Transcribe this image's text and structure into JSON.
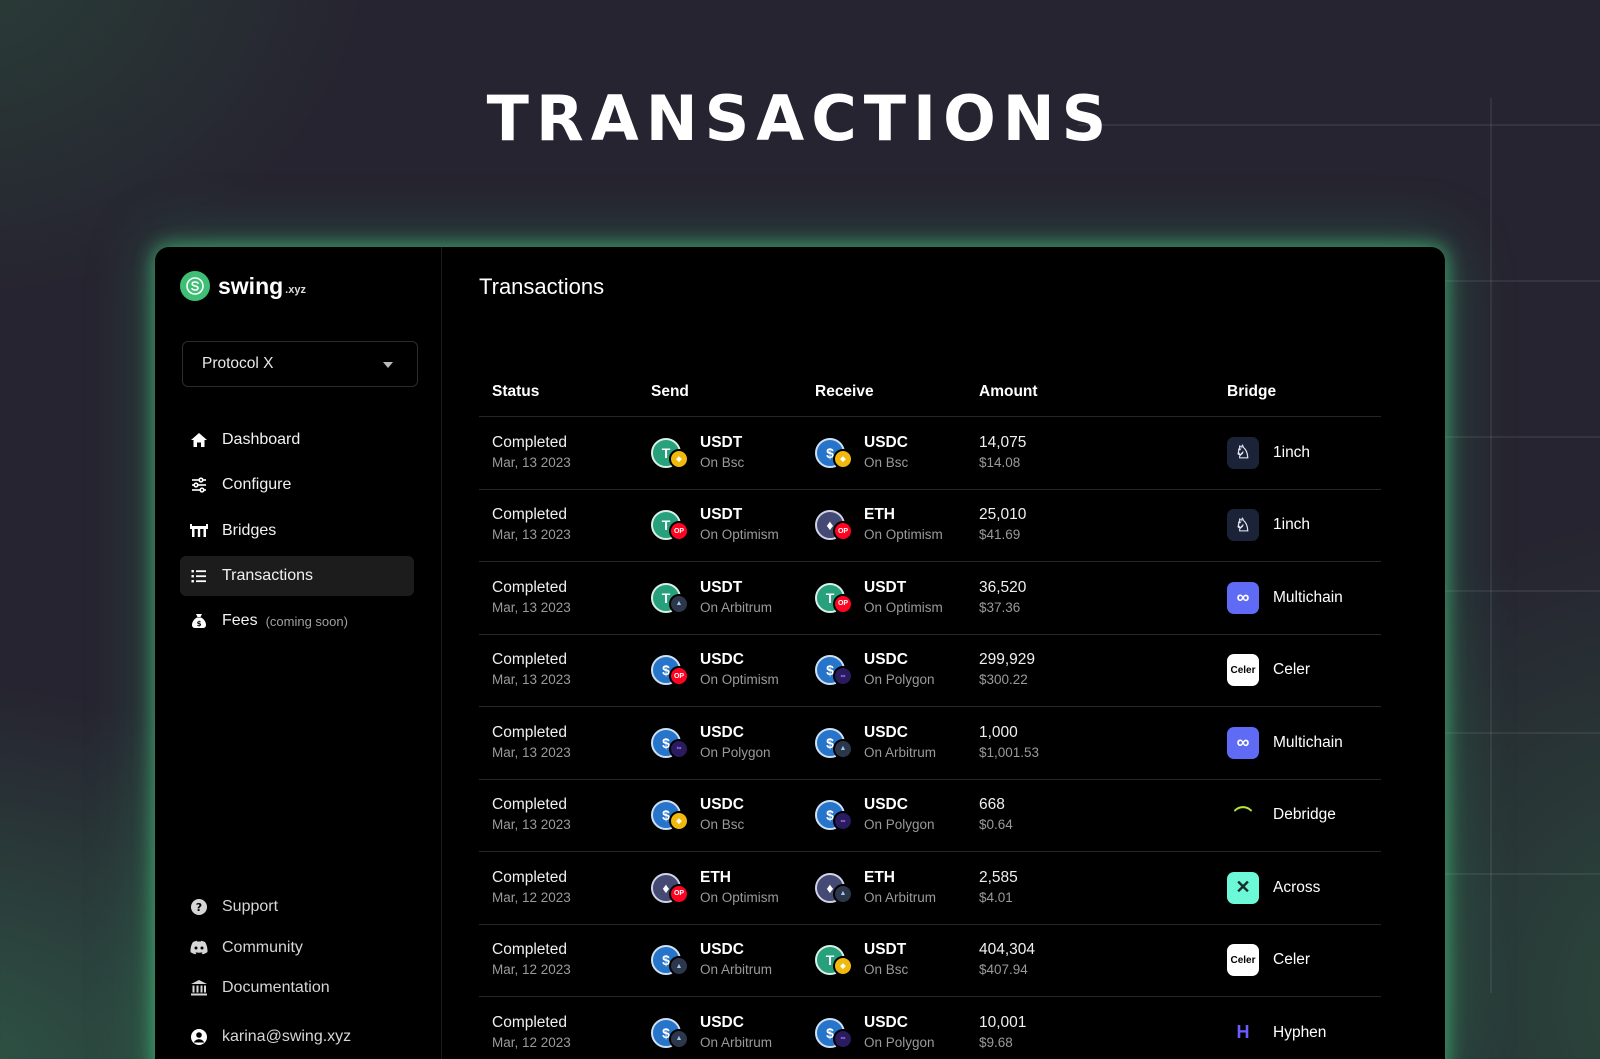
{
  "hero": {
    "title": "TRANSACTIONS"
  },
  "app": {
    "logo": {
      "text": "swing",
      "suffix": ".xyz"
    },
    "protocol_select": {
      "value": "Protocol X"
    },
    "nav": [
      {
        "label": "Dashboard",
        "icon": "home-icon"
      },
      {
        "label": "Configure",
        "icon": "sliders-icon"
      },
      {
        "label": "Bridges",
        "icon": "bridge-icon"
      },
      {
        "label": "Transactions",
        "icon": "list-icon",
        "active": true
      },
      {
        "label": "Fees",
        "note": "(coming soon)",
        "icon": "money-bag-icon"
      }
    ],
    "bottom_nav": [
      {
        "label": "Support",
        "icon": "help-icon"
      },
      {
        "label": "Community",
        "icon": "discord-icon"
      },
      {
        "label": "Documentation",
        "icon": "bank-icon"
      },
      {
        "label": "karina@swing.xyz",
        "icon": "user-icon"
      }
    ]
  },
  "main": {
    "title": "Transactions",
    "columns": {
      "status": "Status",
      "send": "Send",
      "receive": "Receive",
      "amount": "Amount",
      "bridge": "Bridge"
    },
    "rows": [
      {
        "status": "Completed",
        "date": "Mar, 13 2023",
        "send": {
          "token": "USDT",
          "chain": "On Bsc"
        },
        "receive": {
          "token": "USDC",
          "chain": "On Bsc"
        },
        "amount": "14,075",
        "usd": "$14.08",
        "bridge": "1inch"
      },
      {
        "status": "Completed",
        "date": "Mar, 13 2023",
        "send": {
          "token": "USDT",
          "chain": "On Optimism"
        },
        "receive": {
          "token": "ETH",
          "chain": "On Optimism"
        },
        "amount": "25,010",
        "usd": "$41.69",
        "bridge": "1inch"
      },
      {
        "status": "Completed",
        "date": "Mar, 13 2023",
        "send": {
          "token": "USDT",
          "chain": "On Arbitrum"
        },
        "receive": {
          "token": "USDT",
          "chain": "On Optimism"
        },
        "amount": "36,520",
        "usd": "$37.36",
        "bridge": "Multichain"
      },
      {
        "status": "Completed",
        "date": "Mar, 13 2023",
        "send": {
          "token": "USDC",
          "chain": "On Optimism"
        },
        "receive": {
          "token": "USDC",
          "chain": "On Polygon"
        },
        "amount": "299,929",
        "usd": "$300.22",
        "bridge": "Celer"
      },
      {
        "status": "Completed",
        "date": "Mar, 13 2023",
        "send": {
          "token": "USDC",
          "chain": "On Polygon"
        },
        "receive": {
          "token": "USDC",
          "chain": "On Arbitrum"
        },
        "amount": "1,000",
        "usd": "$1,001.53",
        "bridge": "Multichain"
      },
      {
        "status": "Completed",
        "date": "Mar, 13 2023",
        "send": {
          "token": "USDC",
          "chain": "On Bsc"
        },
        "receive": {
          "token": "USDC",
          "chain": "On Polygon"
        },
        "amount": "668",
        "usd": "$0.64",
        "bridge": "Debridge"
      },
      {
        "status": "Completed",
        "date": "Mar, 12 2023",
        "send": {
          "token": "ETH",
          "chain": "On Optimism"
        },
        "receive": {
          "token": "ETH",
          "chain": "On Arbitrum"
        },
        "amount": "2,585",
        "usd": "$4.01",
        "bridge": "Across"
      },
      {
        "status": "Completed",
        "date": "Mar, 12 2023",
        "send": {
          "token": "USDC",
          "chain": "On Arbitrum"
        },
        "receive": {
          "token": "USDT",
          "chain": "On Bsc"
        },
        "amount": "404,304",
        "usd": "$407.94",
        "bridge": "Celer"
      },
      {
        "status": "Completed",
        "date": "Mar, 12 2023",
        "send": {
          "token": "USDC",
          "chain": "On Arbitrum"
        },
        "receive": {
          "token": "USDC",
          "chain": "On Polygon"
        },
        "amount": "10,001",
        "usd": "$9.68",
        "bridge": "Hyphen"
      }
    ]
  },
  "colors": {
    "background": "#262430",
    "panel": "#000000",
    "glow": "#4edc8c",
    "accent": "#3fbf76"
  }
}
